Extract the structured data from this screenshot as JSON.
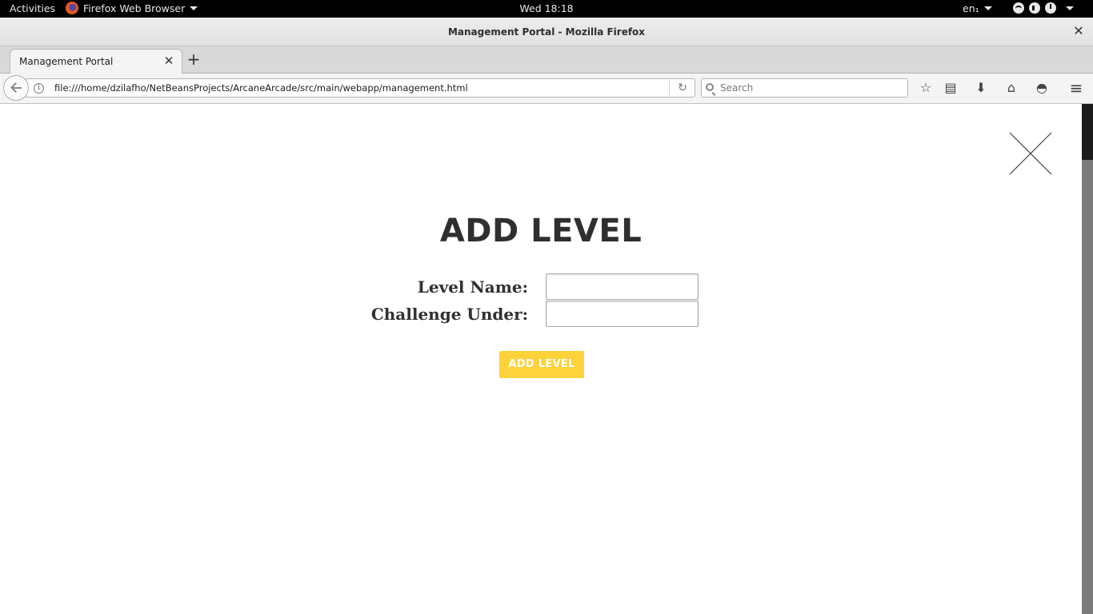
{
  "system_bar": {
    "activities": "Activities",
    "app_name": "Firefox Web Browser",
    "clock": "Wed 18:18",
    "language": "en₁"
  },
  "window": {
    "title": "Management Portal - Mozilla Firefox",
    "close_glyph": "✕"
  },
  "tabs": [
    {
      "label": "Management Portal",
      "close_glyph": "✕"
    }
  ],
  "new_tab_glyph": "+",
  "navbar": {
    "url": "file:///home/dzilafho/NetBeansProjects/ArcaneArcade/src/main/webapp/management.html",
    "search_placeholder": "Search",
    "info_glyph": "i",
    "reload_glyph": "↻",
    "icons": {
      "bookmark": "☆",
      "reader": "▤",
      "downloads": "⬇",
      "home": "⌂",
      "pocket": "◓",
      "menu": "≡"
    }
  },
  "page": {
    "heading": "ADD LEVEL",
    "fields": [
      {
        "label": "Level Name:",
        "value": ""
      },
      {
        "label": "Challenge Under:",
        "value": ""
      }
    ],
    "submit_label": "ADD LEVEL",
    "accent_color": "#fdd23a"
  }
}
